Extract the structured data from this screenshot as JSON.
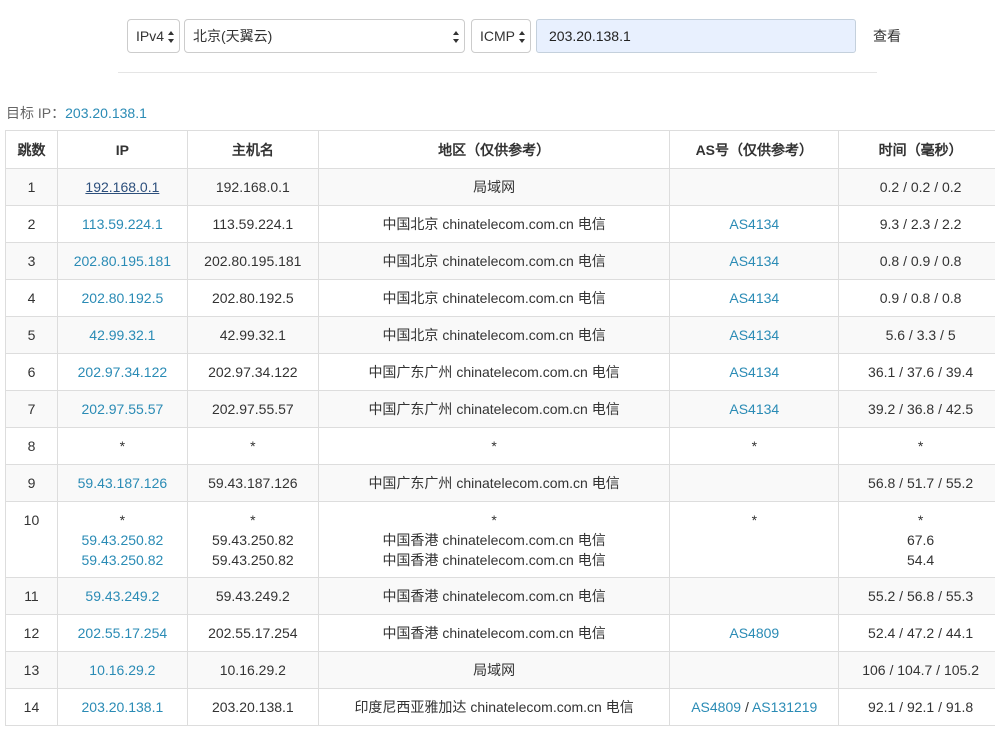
{
  "controls": {
    "ip_version": "IPv4",
    "node": "北京(天翼云)",
    "protocol": "ICMP",
    "target_value": "203.20.138.1",
    "view_label": "查看"
  },
  "target_label": "目标 IP：",
  "target_ip": "203.20.138.1",
  "headers": {
    "hop": "跳数",
    "ip": "IP",
    "host": "主机名",
    "location": "地区（仅供参考）",
    "as": "AS号（仅供参考）",
    "time": "时间（毫秒）"
  },
  "sep": "/",
  "rows": [
    {
      "hop": "1",
      "ip": "192.168.0.1",
      "host": "192.168.0.1",
      "loc": "局域网",
      "as": "",
      "time": "0.2 / 0.2 / 0.2"
    },
    {
      "hop": "2",
      "ip": "113.59.224.1",
      "host": "113.59.224.1",
      "loc": "中国北京 chinatelecom.com.cn 电信",
      "as": "AS4134",
      "time": "9.3 / 2.3 / 2.2"
    },
    {
      "hop": "3",
      "ip": "202.80.195.181",
      "host": "202.80.195.181",
      "loc": "中国北京 chinatelecom.com.cn 电信",
      "as": "AS4134",
      "time": "0.8 / 0.9 / 0.8"
    },
    {
      "hop": "4",
      "ip": "202.80.192.5",
      "host": "202.80.192.5",
      "loc": "中国北京 chinatelecom.com.cn 电信",
      "as": "AS4134",
      "time": "0.9 / 0.8 / 0.8"
    },
    {
      "hop": "5",
      "ip": "42.99.32.1",
      "host": "42.99.32.1",
      "loc": "中国北京 chinatelecom.com.cn 电信",
      "as": "AS4134",
      "time": "5.6 / 3.3 / 5"
    },
    {
      "hop": "6",
      "ip": "202.97.34.122",
      "host": "202.97.34.122",
      "loc": "中国广东广州 chinatelecom.com.cn 电信",
      "as": "AS4134",
      "time": "36.1 / 37.6 / 39.4"
    },
    {
      "hop": "7",
      "ip": "202.97.55.57",
      "host": "202.97.55.57",
      "loc": "中国广东广州 chinatelecom.com.cn 电信",
      "as": "AS4134",
      "time": "39.2 / 36.8 / 42.5"
    },
    {
      "hop": "8",
      "ip": "*",
      "host": "*",
      "loc": "*",
      "as": "*",
      "time": "*"
    },
    {
      "hop": "9",
      "ip": "59.43.187.126",
      "host": "59.43.187.126",
      "loc": "中国广东广州 chinatelecom.com.cn 电信",
      "as": "",
      "time": "56.8 / 51.7 / 55.2"
    },
    {
      "hop": "10",
      "multi": true,
      "ip": "*",
      "ip2": "59.43.250.82",
      "ip3": "59.43.250.82",
      "host": "*",
      "host2": "59.43.250.82",
      "host3": "59.43.250.82",
      "loc": "*",
      "loc2": "中国香港 chinatelecom.com.cn 电信",
      "loc3": "中国香港 chinatelecom.com.cn 电信",
      "as": "*",
      "time": "*",
      "time2": "67.6",
      "time3": "54.4"
    },
    {
      "hop": "11",
      "ip": "59.43.249.2",
      "host": "59.43.249.2",
      "loc": "中国香港 chinatelecom.com.cn 电信",
      "as": "",
      "time": "55.2 / 56.8 / 55.3"
    },
    {
      "hop": "12",
      "ip": "202.55.17.254",
      "host": "202.55.17.254",
      "loc": "中国香港 chinatelecom.com.cn 电信",
      "as": "AS4809",
      "time": "52.4 / 47.2 / 44.1"
    },
    {
      "hop": "13",
      "ip": "10.16.29.2",
      "host": "10.16.29.2",
      "loc": "局域网",
      "as": "",
      "time": "106 / 104.7 / 105.2"
    },
    {
      "hop": "14",
      "ip": "203.20.138.1",
      "host": "203.20.138.1",
      "loc": "印度尼西亚雅加达 chinatelecom.com.cn 电信",
      "as": "AS4809",
      "as_extra": "AS131219",
      "time": "92.1 / 92.1 / 91.8"
    }
  ],
  "colors": {
    "link": "#2a8bb5",
    "visited_link": "#2c4f7c",
    "input_bg": "#e8f0fe",
    "stripe": "#f9f9f9",
    "border": "#dddddd"
  },
  "icons": {
    "select_arrow": "up-down-chevron-icon"
  }
}
